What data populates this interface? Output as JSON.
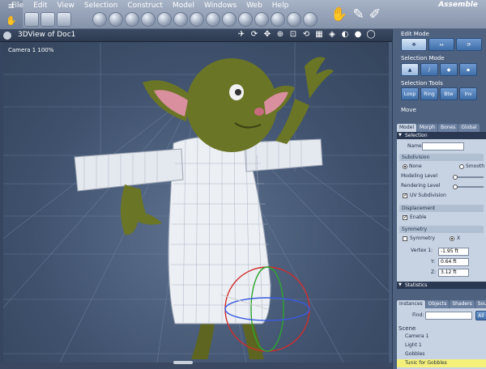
{
  "menubar": {
    "items": [
      "File",
      "Edit",
      "View",
      "Selection",
      "Construct",
      "Model",
      "Windows",
      "Web",
      "Help"
    ],
    "room": "Assemble"
  },
  "viewport": {
    "title": "3DView of Doc1",
    "camera_label": "Camera 1 100%"
  },
  "edit_mode": {
    "label": "Edit Mode"
  },
  "selection_mode": {
    "label": "Selection Mode"
  },
  "selection_tools": {
    "label": "Selection Tools",
    "buttons": [
      "Loop",
      "Ring",
      "Btw",
      "Inv"
    ],
    "move_label": "Move"
  },
  "properties": {
    "tabs": [
      "Model",
      "Morph",
      "Bones",
      "Global"
    ],
    "selection_header": "Selection",
    "name_label": "Name:",
    "name_value": "",
    "subdivision_label": "Subdivision",
    "subdivision_none": "None",
    "subdivision_smooth": "Smooth",
    "modeling_level": "Modeling Level",
    "rendering_level": "Rendering Level",
    "uv_subdivision": "UV Subdivision",
    "displacement_label": "Displacement",
    "enable_label": "Enable",
    "symmetry_label": "Symmetry",
    "symmetry_check": "Symmetry",
    "axis_x": "X",
    "vertex_label": "Vertex 1:",
    "x_label": "X:",
    "x_value": "-1.95 ft",
    "y_label": "Y:",
    "y_value": "0.64 ft",
    "z_label": "Z:",
    "z_value": "3.12 ft",
    "statistics_header": "Statistics"
  },
  "instances": {
    "tabs": [
      "Instances",
      "Objects",
      "Shaders",
      "Sou"
    ],
    "find_label": "Find:",
    "all_button": "All",
    "scene_label": "Scene",
    "scene_items": [
      "Camera 1",
      "Light 1",
      "Gobbles",
      "Tunic for Gobbles"
    ]
  },
  "colors": {
    "accent": "#4a7cc0",
    "selected_row": "#f5f07a",
    "viewport_bg": "#3f516d",
    "figure_skin": "#6b7526"
  }
}
